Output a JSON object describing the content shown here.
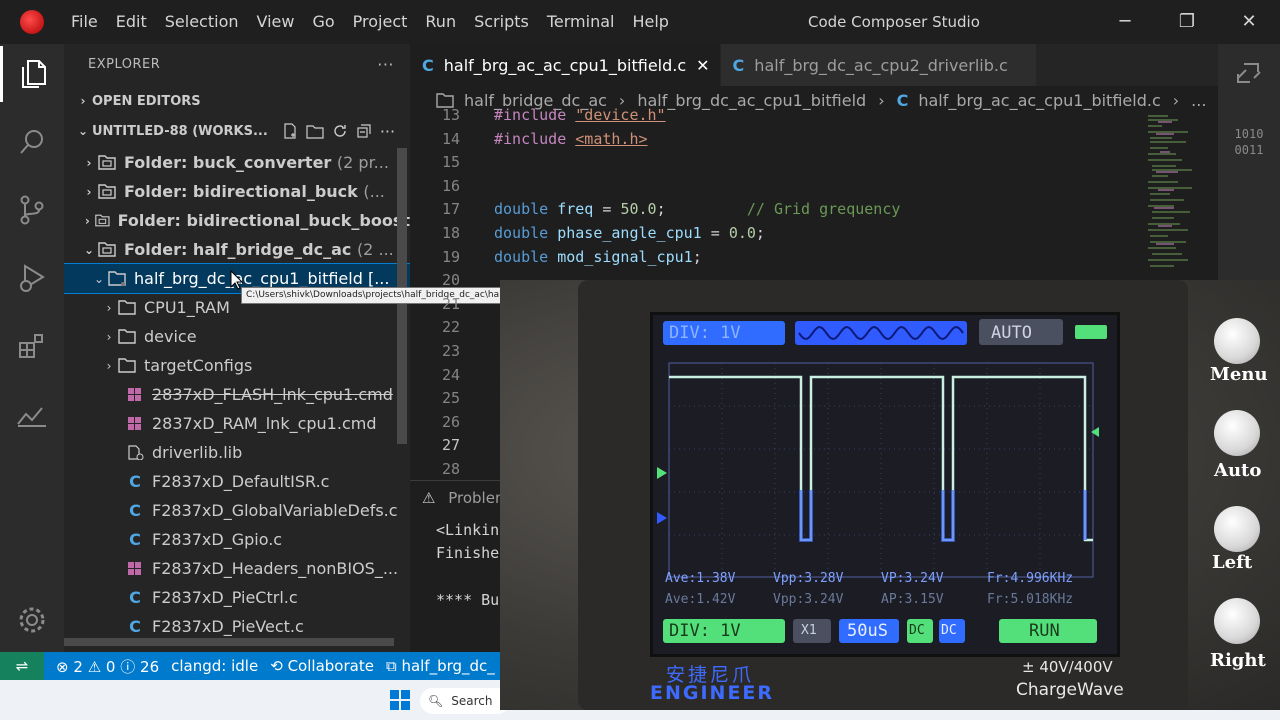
{
  "titlebar": {
    "menu": [
      "File",
      "Edit",
      "Selection",
      "View",
      "Go",
      "Project",
      "Run",
      "Scripts",
      "Terminal",
      "Help"
    ],
    "title": "Code Composer Studio",
    "minimize": "─",
    "restore": "❐",
    "close": "✕"
  },
  "activity": [
    "files-icon",
    "search-icon",
    "source-control-icon",
    "run-debug-icon",
    "extensions-icon",
    "analytics-icon",
    "settings-gear-icon"
  ],
  "sidebar": {
    "header": "EXPLORER",
    "more": "···",
    "open_editors": "OPEN EDITORS",
    "workspace": "UNTITLED-88 (WORKS...",
    "tree": [
      {
        "label": "Folder: buck_converter",
        "suffix": "(2 pr...",
        "chev": "›"
      },
      {
        "label": "Folder: bidirectional_buck",
        "suffix": "(...",
        "chev": "›"
      },
      {
        "label": "Folder: bidirectional_buck_boost",
        "suffix": "",
        "chev": "›"
      },
      {
        "label": "Folder: half_bridge_dc_ac",
        "suffix": "(2 ...",
        "chev": "⌄"
      },
      {
        "label": "half_brg_dc_ac_cpu1_bitfield",
        "suffix": "[...",
        "chev": "⌄"
      },
      {
        "label": "CPU1_RAM",
        "chev": "›"
      },
      {
        "label": "device",
        "chev": "›"
      },
      {
        "label": "targetConfigs",
        "chev": "›"
      },
      {
        "label": "2837xD_FLASH_lnk_cpu1.cmd"
      },
      {
        "label": "2837xD_RAM_lnk_cpu1.cmd"
      },
      {
        "label": "driverlib.lib"
      },
      {
        "label": "F2837xD_DefaultISR.c"
      },
      {
        "label": "F2837xD_GlobalVariableDefs.c"
      },
      {
        "label": "F2837xD_Gpio.c"
      },
      {
        "label": "F2837xD_Headers_nonBIOS_..."
      },
      {
        "label": "F2837xD_PieCtrl.c"
      },
      {
        "label": "F2837xD_PieVect.c"
      }
    ],
    "tooltip": "C:\\Users\\shivk\\Downloads\\projects\\half_bridge_dc_ac\\hal"
  },
  "editor": {
    "tabs": [
      {
        "icon": "C",
        "label": "half_brg_ac_ac_cpu1_bitfield.c",
        "close": "✕"
      },
      {
        "icon": "C",
        "label": "half_brg_dc_ac_cpu2_driverlib.c"
      }
    ],
    "breadcrumb": [
      "half_bridge_dc_ac",
      "half_brg_dc_ac_cpu1_bitfield",
      "half_brg_ac_ac_cpu1_bitfield.c",
      "..."
    ],
    "lines": [
      {
        "n": "13",
        "parts": [
          [
            "kw",
            "#include "
          ],
          [
            "str",
            "\"device.h\""
          ]
        ]
      },
      {
        "n": "14",
        "parts": [
          [
            "kw",
            "#include "
          ],
          [
            "str",
            "<math.h>"
          ]
        ]
      },
      {
        "n": "15",
        "parts": []
      },
      {
        "n": "16",
        "parts": []
      },
      {
        "n": "17",
        "parts": [
          [
            "ty",
            "double "
          ],
          [
            "id",
            "freq"
          ],
          [
            "pl",
            " = "
          ],
          [
            "num",
            "50.0"
          ],
          [
            "pl",
            ";         "
          ],
          [
            "cm",
            "// Grid grequency"
          ]
        ]
      },
      {
        "n": "18",
        "parts": [
          [
            "ty",
            "double "
          ],
          [
            "id",
            "phase_angle_cpu1"
          ],
          [
            "pl",
            " = "
          ],
          [
            "num",
            "0.0"
          ],
          [
            "pl",
            ";"
          ]
        ]
      },
      {
        "n": "19",
        "parts": [
          [
            "ty",
            "double "
          ],
          [
            "id",
            "mod_signal_cpu1"
          ],
          [
            "pl",
            ";"
          ]
        ]
      },
      {
        "n": "20",
        "parts": []
      },
      {
        "n": "21",
        "parts": []
      },
      {
        "n": "22",
        "parts": []
      },
      {
        "n": "23",
        "parts": []
      },
      {
        "n": "24",
        "parts": []
      },
      {
        "n": "25",
        "parts": []
      },
      {
        "n": "26",
        "parts": []
      },
      {
        "n": "27",
        "parts": []
      },
      {
        "n": "28",
        "parts": []
      }
    ],
    "minimap_binary": "1010\n0011"
  },
  "panel": {
    "tab": "Problems",
    "lines": [
      "<Linking>",
      "Finished",
      "",
      "**** Build"
    ]
  },
  "status": {
    "remote": "⇌",
    "errors": "2",
    "warnings": "0",
    "info": "26",
    "clangd": "clangd: idle",
    "collaborate": "Collaborate",
    "project": "half_brg_dc_"
  },
  "taskbar": {
    "search": "Search"
  },
  "oscilloscope": {
    "div_top": "DIV:    1V",
    "mode": "AUTO",
    "readings": [
      [
        "Ave:1.38V",
        "Vpp:3.28V",
        "VP:3.24V",
        "Fr:4.996KHz"
      ],
      [
        "Ave:1.42V",
        "Vpp:3.24V",
        "AP:3.15V",
        "Fr:5.018KHz"
      ]
    ],
    "div_bottom": "DIV:     1V",
    "probe": "X1",
    "timebase": "50uS",
    "coupling": "DC",
    "coupling2": "DC",
    "run": "RUN",
    "brand_cn": "安捷尼爪",
    "brand": "ENGINEER",
    "rating": "± 40V/400V",
    "model": "ChargeWave",
    "buttons": [
      "Menu",
      "Auto",
      "Left",
      "Right"
    ],
    "colors": {
      "trace": "#c9f0e0",
      "blue": "#2f5bff",
      "green": "#53e07a",
      "hud_text": "#7fa0ff"
    }
  }
}
